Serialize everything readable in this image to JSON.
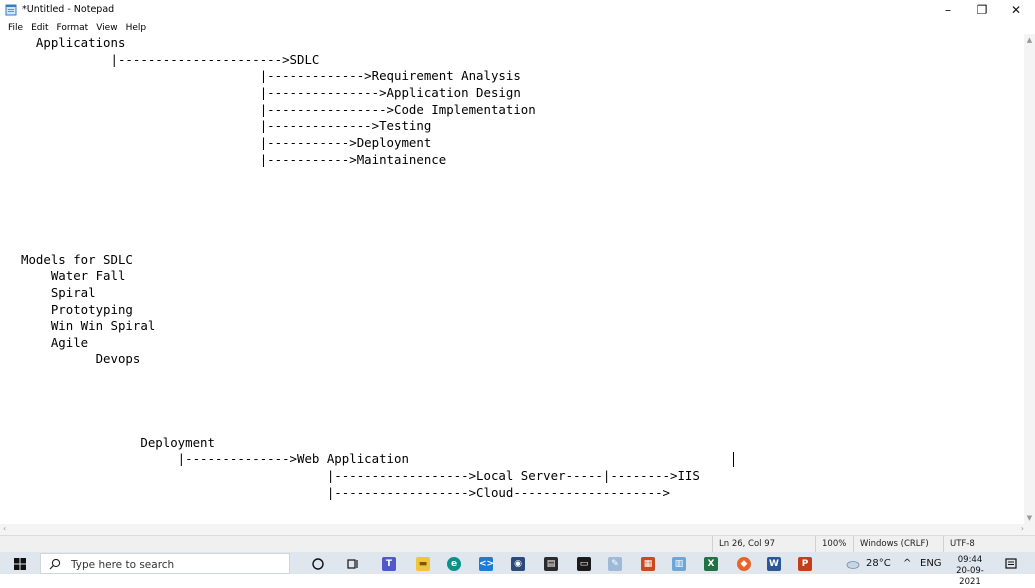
{
  "window": {
    "title": "*Untitled - Notepad",
    "minimize_glyph": "–",
    "restore_glyph": "❐",
    "close_glyph": "✕"
  },
  "menu": [
    "File",
    "Edit",
    "Format",
    "View",
    "Help"
  ],
  "editor": {
    "content": "  Applications\n            |---------------------->SDLC\n                                |------------->Requirement Analysis\n                                |--------------->Application Design\n                                |---------------->Code Implementation\n                                |-------------->Testing\n                                |----------->Deployment\n                                |----------->Maintainence\n\n\n\n\n\nModels for SDLC\n    Water Fall\n    Spiral\n    Prototyping\n    Win Win Spiral\n    Agile\n          Devops\n\n\n\n\n                Deployment\n                     |-------------->Web Application\n                                         |------------------>Local Server-----|-------->IIS\n                                         |------------------>Cloud-------------------->"
  },
  "scroll": {
    "up": "▲",
    "down": "▼",
    "left": "‹",
    "right": "›"
  },
  "status": {
    "position": "Ln 26, Col 97",
    "zoom": "100%",
    "line_ending": "Windows (CRLF)",
    "encoding": "UTF-8"
  },
  "taskbar": {
    "search_placeholder": "Type here to search",
    "weather": "28°C",
    "tray_chevron": "^",
    "language": "ENG",
    "time": "09:44",
    "date": "20-09-2021"
  }
}
